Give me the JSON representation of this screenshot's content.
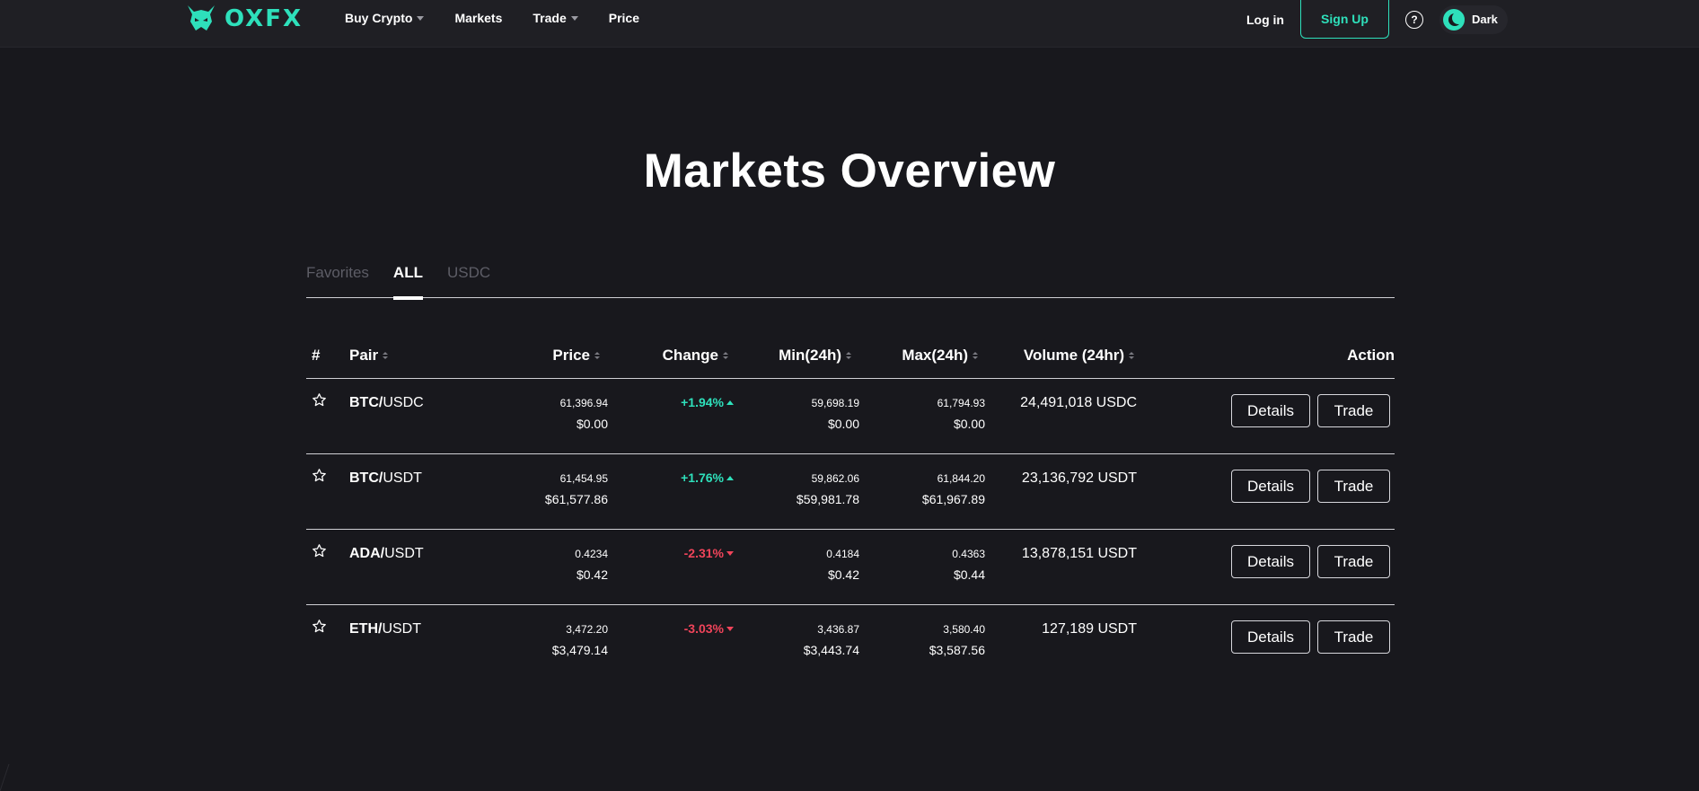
{
  "header": {
    "logo_text": "OXFX",
    "nav": [
      {
        "label": "Buy Crypto",
        "dropdown": true
      },
      {
        "label": "Markets",
        "dropdown": false
      },
      {
        "label": "Trade",
        "dropdown": true
      },
      {
        "label": "Price",
        "dropdown": false
      }
    ],
    "login_label": "Log in",
    "signup_label": "Sign Up",
    "help_icon": "?",
    "theme_label": "Dark"
  },
  "page_title": "Markets Overview",
  "tabs": [
    {
      "label": "Favorites",
      "active": false
    },
    {
      "label": "ALL",
      "active": true
    },
    {
      "label": "USDC",
      "active": false
    }
  ],
  "table": {
    "columns": {
      "index": "#",
      "pair": "Pair",
      "price": "Price",
      "change": "Change",
      "min": "Min(24h)",
      "max": "Max(24h)",
      "volume": "Volume (24hr)",
      "action": "Action"
    },
    "rows": [
      {
        "base": "BTC",
        "sep": "/",
        "quote": "USDC",
        "price": "61,396.94",
        "price_usd": "$0.00",
        "change": "+1.94%",
        "direction": "up",
        "min": "59,698.19",
        "min_usd": "$0.00",
        "max": "61,794.93",
        "max_usd": "$0.00",
        "volume": "24,491,018 USDC",
        "details_label": "Details",
        "trade_label": "Trade"
      },
      {
        "base": "BTC",
        "sep": "/",
        "quote": "USDT",
        "price": "61,454.95",
        "price_usd": "$61,577.86",
        "change": "+1.76%",
        "direction": "up",
        "min": "59,862.06",
        "min_usd": "$59,981.78",
        "max": "61,844.20",
        "max_usd": "$61,967.89",
        "volume": "23,136,792 USDT",
        "details_label": "Details",
        "trade_label": "Trade"
      },
      {
        "base": "ADA",
        "sep": "/",
        "quote": "USDT",
        "price": "0.4234",
        "price_usd": "$0.42",
        "change": "-2.31%",
        "direction": "down",
        "min": "0.4184",
        "min_usd": "$0.42",
        "max": "0.4363",
        "max_usd": "$0.44",
        "volume": "13,878,151 USDT",
        "details_label": "Details",
        "trade_label": "Trade"
      },
      {
        "base": "ETH",
        "sep": "/",
        "quote": "USDT",
        "price": "3,472.20",
        "price_usd": "$3,479.14",
        "change": "-3.03%",
        "direction": "down",
        "min": "3,436.87",
        "min_usd": "$3,443.74",
        "max": "3,580.40",
        "max_usd": "$3,587.56",
        "volume": "127,189 USDT",
        "details_label": "Details",
        "trade_label": "Trade"
      }
    ]
  },
  "colors": {
    "background": "#18181d",
    "header_bg": "#1f1f24",
    "accent": "#2ee0bb",
    "positive": "#2ee0bb",
    "negative": "#f0445a"
  },
  "icons": {
    "logo": "horned-mask-icon",
    "favorite": "star-outline-icon",
    "help": "question-circle-icon",
    "theme": "moon-icon"
  }
}
